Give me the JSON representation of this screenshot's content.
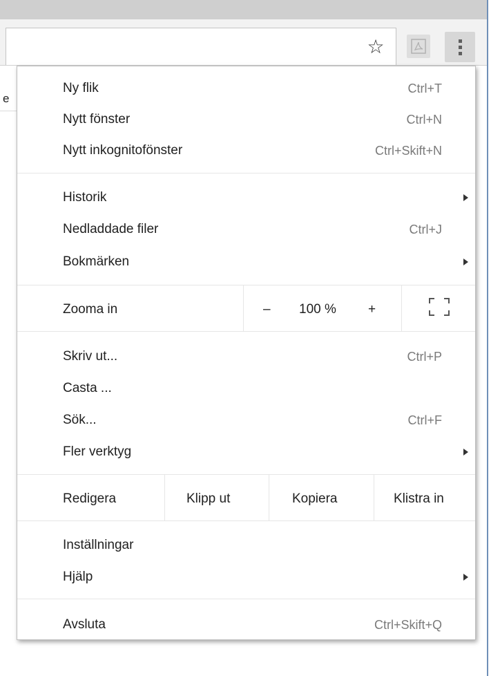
{
  "browser": {
    "star_glyph": "☆",
    "left_clip_text": "e"
  },
  "menu": {
    "new_tab": {
      "label": "Ny flik",
      "shortcut": "Ctrl+T"
    },
    "new_window": {
      "label": "Nytt fönster",
      "shortcut": "Ctrl+N"
    },
    "new_incognito": {
      "label": "Nytt inkognitofönster",
      "shortcut": "Ctrl+Skift+N"
    },
    "history": {
      "label": "Historik"
    },
    "downloads": {
      "label": "Nedladdade filer",
      "shortcut": "Ctrl+J"
    },
    "bookmarks": {
      "label": "Bokmärken"
    },
    "zoom": {
      "label": "Zooma in",
      "minus": "–",
      "value": "100 %",
      "plus": "+"
    },
    "print": {
      "label": "Skriv ut...",
      "shortcut": "Ctrl+P"
    },
    "cast": {
      "label": "Casta ..."
    },
    "find": {
      "label": "Sök...",
      "shortcut": "Ctrl+F"
    },
    "more_tools": {
      "label": "Fler verktyg"
    },
    "edit": {
      "label": "Redigera",
      "cut": "Klipp ut",
      "copy": "Kopiera",
      "paste": "Klistra in"
    },
    "settings": {
      "label": "Inställningar"
    },
    "help": {
      "label": "Hjälp"
    },
    "exit": {
      "label": "Avsluta",
      "shortcut": "Ctrl+Skift+Q"
    }
  }
}
